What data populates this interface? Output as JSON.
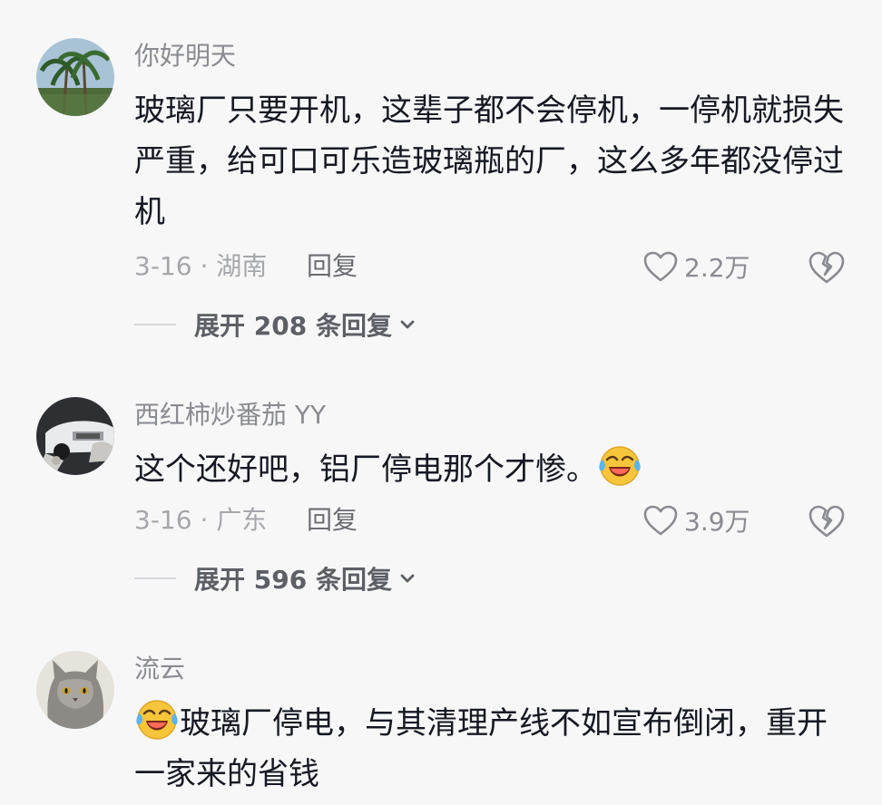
{
  "comments": [
    {
      "username": "你好明天",
      "text": "玻璃厂只要开机，这辈子都不会停机，一停机就损失严重，给可口可乐造玻璃瓶的厂，这么多年都没停过机",
      "date_location": "3-16 · 湖南",
      "reply_label": "回复",
      "likes": "2.2万",
      "expand_label": "展开 208 条回复",
      "avatar_icon": "palm-tree-avatar"
    },
    {
      "username": "西红柿炒番茄 YY",
      "text": "这个还好吧，铝厂停电那个才惨。",
      "date_location": "3-16 · 广东",
      "reply_label": "回复",
      "likes": "3.9万",
      "expand_label": "展开 596 条回复",
      "avatar_icon": "car-avatar",
      "emoji_icon": "laugh-cry-emoji"
    },
    {
      "username": "流云",
      "text": "玻璃厂停电，与其清理产线不如宣布倒闭，重开一家来的省钱",
      "avatar_icon": "cat-avatar",
      "emoji_icon": "laugh-cry-emoji"
    }
  ],
  "icons": {
    "like": "heart-outline-icon",
    "dislike": "broken-heart-icon",
    "expand": "chevron-down-icon"
  },
  "colors": {
    "background": "#f7f7f7",
    "text_primary": "#161823",
    "text_secondary": "#8a8b91",
    "text_meta": "#a6a7ab"
  }
}
